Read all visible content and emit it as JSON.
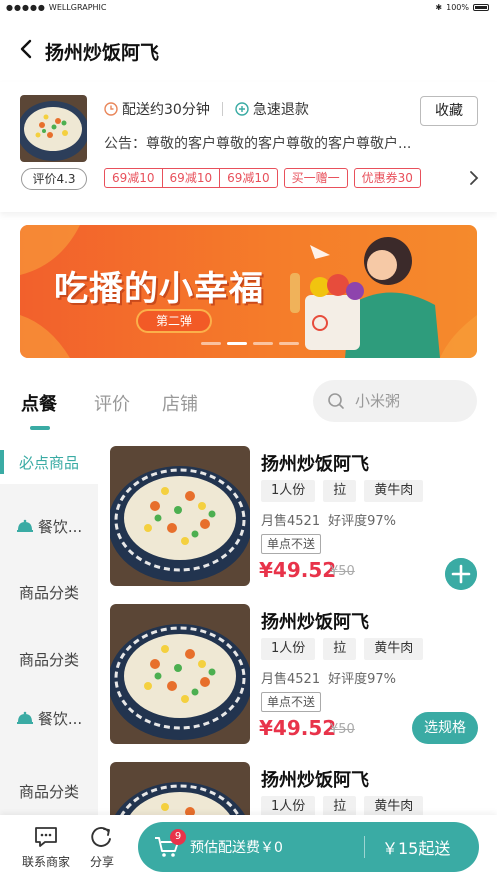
{
  "status_bar": {
    "carrier": "WELLGRAPHIC",
    "battery": "100%"
  },
  "nav": {
    "title": "扬州炒饭阿飞"
  },
  "shop": {
    "rating": "评价4.3",
    "delivery_time": "配送约30分钟",
    "refund": "急速退款",
    "favorite_label": "收藏",
    "notice": "公告：尊敬的客户尊敬的客户尊敬的客户尊敬户...",
    "coupon_group": [
      "69减10",
      "69减10",
      "69减10"
    ],
    "coupons": [
      "买一赠一",
      "优惠券30"
    ]
  },
  "banner": {
    "title": "吃播的小幸福",
    "subtitle": "第二弹"
  },
  "tabs": [
    {
      "label": "点餐",
      "active": true
    },
    {
      "label": "评价",
      "active": false
    },
    {
      "label": "店铺",
      "active": false
    }
  ],
  "search": {
    "placeholder": "小米粥"
  },
  "sidebar": {
    "items": [
      {
        "label": "必点商品",
        "active": true,
        "icon": ""
      },
      {
        "label": "餐饮...",
        "active": false,
        "icon": "cloche-icon"
      },
      {
        "label": "商品分类",
        "active": false,
        "icon": ""
      },
      {
        "label": "商品分类",
        "active": false,
        "icon": ""
      },
      {
        "label": "餐饮...",
        "active": false,
        "icon": "cloche-icon"
      },
      {
        "label": "商品分类",
        "active": false,
        "icon": ""
      }
    ]
  },
  "dishes": [
    {
      "name": "扬州炒饭阿飞",
      "tags": [
        "1人份",
        "拉",
        "黄牛肉"
      ],
      "monthly_sales": "月售4521",
      "rating": "好评度97%",
      "note": "单点不送",
      "price": "¥49.52",
      "old_price": "¥50",
      "action": "add"
    },
    {
      "name": "扬州炒饭阿飞",
      "tags": [
        "1人份",
        "拉",
        "黄牛肉"
      ],
      "monthly_sales": "月售4521",
      "rating": "好评度97%",
      "note": "单点不送",
      "price": "¥49.52",
      "old_price": "¥50",
      "action": "spec",
      "action_label": "选规格"
    },
    {
      "name": "扬州炒饭阿飞",
      "tags": [
        "1人份",
        "拉",
        "黄牛肉"
      ]
    }
  ],
  "bottom": {
    "contact_label": "联系商家",
    "share_label": "分享",
    "cart_count": "9",
    "delivery_fee": "预估配送费￥0",
    "min_order": "￥15起送"
  },
  "colors": {
    "accent": "#3aaba4",
    "price": "#e8334a",
    "coupon": "#e8505b"
  }
}
